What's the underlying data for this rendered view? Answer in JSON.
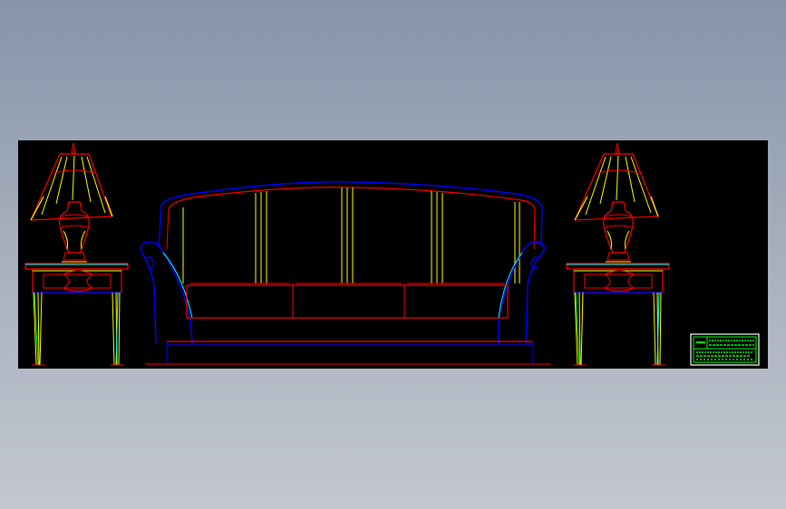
{
  "viewer": {
    "background_top": "#8795aa",
    "background_bottom": "#c3c7cf",
    "canvas_background": "#000000"
  },
  "drawing": {
    "subject": "sofa-with-side-tables-and-lamps-elevation",
    "layer_colors": {
      "red": "#ff0000",
      "blue": "#0000ff",
      "yellow": "#ffff00",
      "cyan": "#00ffff",
      "green": "#00ff00",
      "white": "#ffffff"
    }
  },
  "title_block": {
    "lines": [
      "",
      "",
      "",
      ""
    ]
  }
}
